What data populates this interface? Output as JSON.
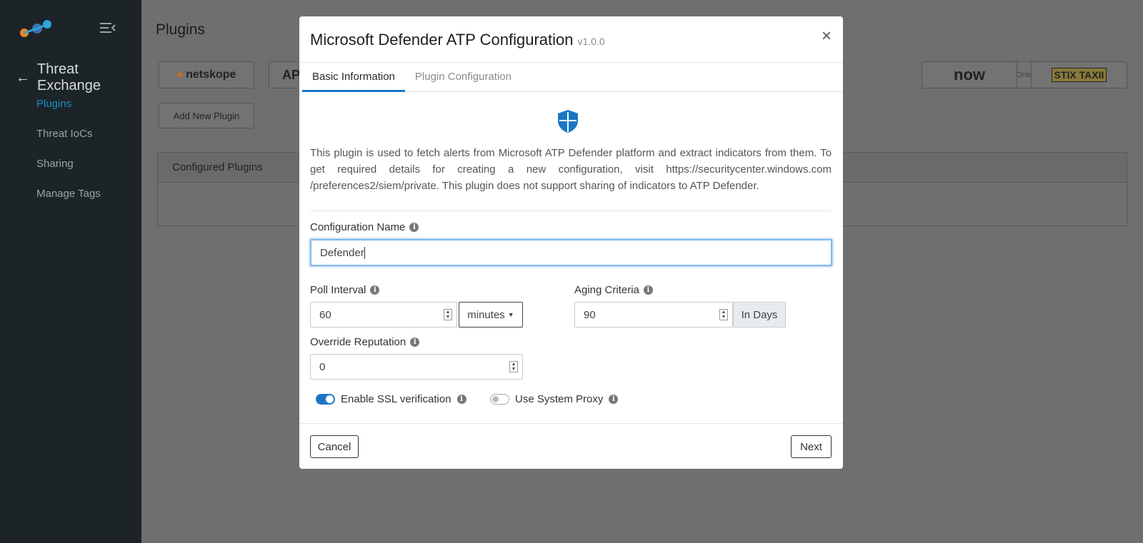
{
  "sidebar": {
    "section_title": "Threat Exchange",
    "items": [
      {
        "label": "Plugins",
        "active": true
      },
      {
        "label": "Threat IoCs"
      },
      {
        "label": "Sharing"
      },
      {
        "label": "Manage Tags"
      }
    ]
  },
  "main": {
    "title": "Plugins",
    "plugin_cards": [
      "netskope",
      "AP",
      "SentinelOne",
      "now",
      "STIX TAXII"
    ],
    "add_plugin_label": "Add New Plugin",
    "configured_header": "Configured Plugins"
  },
  "modal": {
    "title": "Microsoft Defender ATP Configuration",
    "version": "v1.0.0",
    "close_symbol": "×",
    "tabs": [
      {
        "label": "Basic Information",
        "active": true
      },
      {
        "label": "Plugin Configuration",
        "active": false
      }
    ],
    "description": "This plugin is used to fetch alerts from Microsoft ATP Defender platform and extract indicators from them. To get required details for creating a new configuration, visit https://securitycenter.windows.com /preferences2/siem/private. This plugin does not support sharing of indicators to ATP Defender.",
    "config_name": {
      "label": "Configuration Name",
      "value": "Defender"
    },
    "poll_interval": {
      "label": "Poll Interval",
      "value": "60",
      "unit": "minutes"
    },
    "aging_criteria": {
      "label": "Aging Criteria",
      "value": "90",
      "addon": "In Days"
    },
    "override_reputation": {
      "label": "Override Reputation",
      "value": "0"
    },
    "ssl_verification": {
      "label": "Enable SSL verification",
      "enabled": true
    },
    "system_proxy": {
      "label": "Use System Proxy",
      "enabled": false
    },
    "cancel_label": "Cancel",
    "next_label": "Next"
  },
  "colors": {
    "accent": "#1a76c4",
    "sidebar_bg": "#1c2428",
    "active_nav": "#1a8cc7"
  }
}
